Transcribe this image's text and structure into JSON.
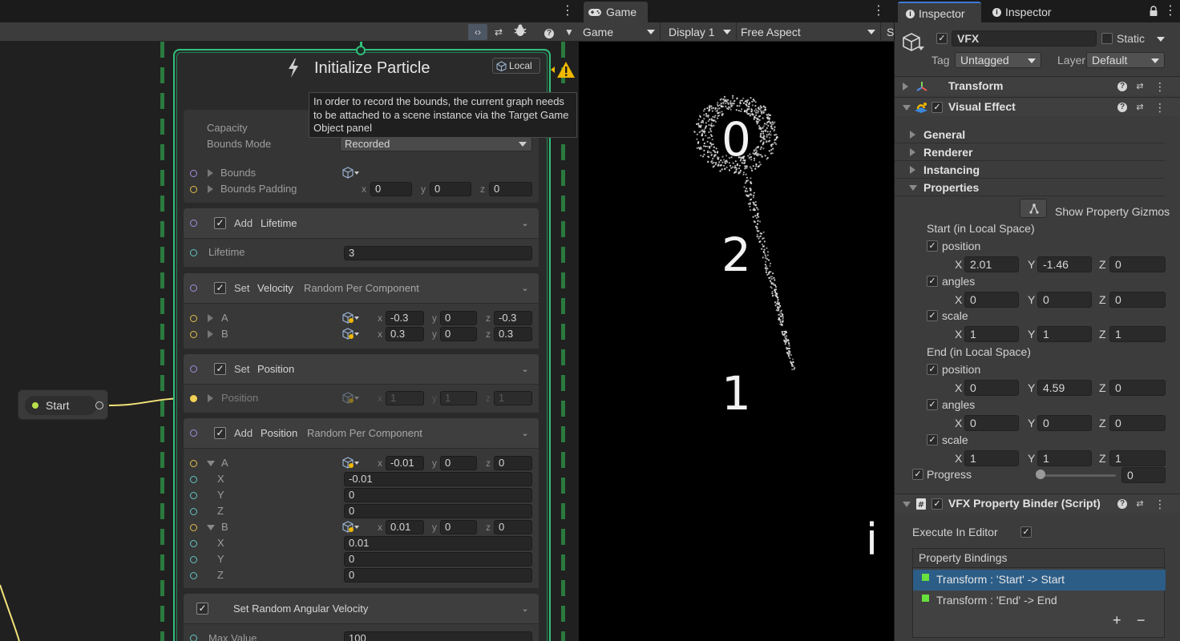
{
  "graph": {
    "node_title": "Initialize Particle",
    "local_label": "Local",
    "tooltip": "In order to record the bounds, the current graph needs to be attached to a scene instance via the Target Game Object panel",
    "capacity_label": "Capacity",
    "bounds_mode_label": "Bounds Mode",
    "bounds_mode_value": "Recorded",
    "bounds_label": "Bounds",
    "bounds_padding_label": "Bounds Padding",
    "bounds_padding": {
      "x": "0",
      "y": "0",
      "z": "0"
    },
    "blocks": {
      "lifetime": {
        "verb": "Add",
        "attr": "Lifetime",
        "field_label": "Lifetime",
        "field_value": "3"
      },
      "velocity": {
        "verb": "Set",
        "attr": "Velocity",
        "mode": "Random Per Component",
        "a_label": "A",
        "b_label": "B",
        "a": {
          "x": "-0.3",
          "y": "0",
          "z": "-0.3"
        },
        "b": {
          "x": "0.3",
          "y": "0",
          "z": "0.3"
        }
      },
      "set_position": {
        "verb": "Set",
        "attr": "Position",
        "field_label": "Position",
        "value": {
          "x": "1",
          "y": "1",
          "z": "1"
        }
      },
      "add_position": {
        "verb": "Add",
        "attr": "Position",
        "mode": "Random Per Component",
        "a_label": "A",
        "b_label": "B",
        "a": {
          "x": "-0.01",
          "y": "0",
          "z": "0"
        },
        "b": {
          "x": "0.01",
          "y": "0",
          "z": "0"
        },
        "a_rows": [
          {
            "label": "X",
            "value": "-0.01"
          },
          {
            "label": "Y",
            "value": "0"
          },
          {
            "label": "Z",
            "value": "0"
          }
        ],
        "b_rows": [
          {
            "label": "X",
            "value": "0.01"
          },
          {
            "label": "Y",
            "value": "0"
          },
          {
            "label": "Z",
            "value": "0"
          }
        ]
      },
      "angular": {
        "title": "Set Random Angular Velocity",
        "field_label": "Max Value",
        "field_value": "100"
      }
    },
    "axis": {
      "x": "x",
      "y": "y",
      "z": "z"
    },
    "start_node_label": "Start"
  },
  "game": {
    "tab_label": "Game",
    "view_dropdown": "Game",
    "display_dropdown": "Display 1",
    "aspect_dropdown": "Free Aspect",
    "overflow_label": "S",
    "scene_labels": [
      "0",
      "2",
      "1",
      "i"
    ]
  },
  "inspector": {
    "tabs": [
      "Inspector",
      "Inspector"
    ],
    "object_name": "VFX",
    "static_label": "Static",
    "tag_label": "Tag",
    "tag_value": "Untagged",
    "layer_label": "Layer",
    "layer_value": "Default",
    "transform_label": "Transform",
    "visual_effect_label": "Visual Effect",
    "sections": [
      "General",
      "Renderer",
      "Instancing",
      "Properties"
    ],
    "show_gizmos_label": "Show Property Gizmos",
    "start_header": "Start (in Local Space)",
    "end_header": "End (in Local Space)",
    "position_label": "position",
    "angles_label": "angles",
    "scale_label": "scale",
    "axis": {
      "x": "X",
      "y": "Y",
      "z": "Z"
    },
    "start": {
      "position": {
        "x": "2.01",
        "y": "-1.46",
        "z": "0"
      },
      "angles": {
        "x": "0",
        "y": "0",
        "z": "0"
      },
      "scale": {
        "x": "1",
        "y": "1",
        "z": "1"
      }
    },
    "end": {
      "position": {
        "x": "0",
        "y": "4.59",
        "z": "0"
      },
      "angles": {
        "x": "0",
        "y": "0",
        "z": "0"
      },
      "scale": {
        "x": "1",
        "y": "1",
        "z": "1"
      }
    },
    "progress_label": "Progress",
    "progress_value": "0",
    "binder_label": "VFX Property Binder (Script)",
    "execute_label": "Execute In Editor",
    "bindings_header": "Property Bindings",
    "bindings": [
      "Transform : 'Start' -> Start",
      "Transform : 'End' -> End"
    ],
    "add_label": "+",
    "remove_label": "−"
  },
  "icons": {
    "bolt": "lightning-bolt-icon",
    "warning": "warning-triangle-icon",
    "cube": "cube-icon",
    "gamepad": "gamepad-icon",
    "lock": "lock-icon"
  },
  "colors": {
    "context_border": "#2fbf7a",
    "warning": "#f0b800",
    "selection": "#2c5d87",
    "binding_ok": "#67e03c",
    "wire": "#f2e27a"
  }
}
